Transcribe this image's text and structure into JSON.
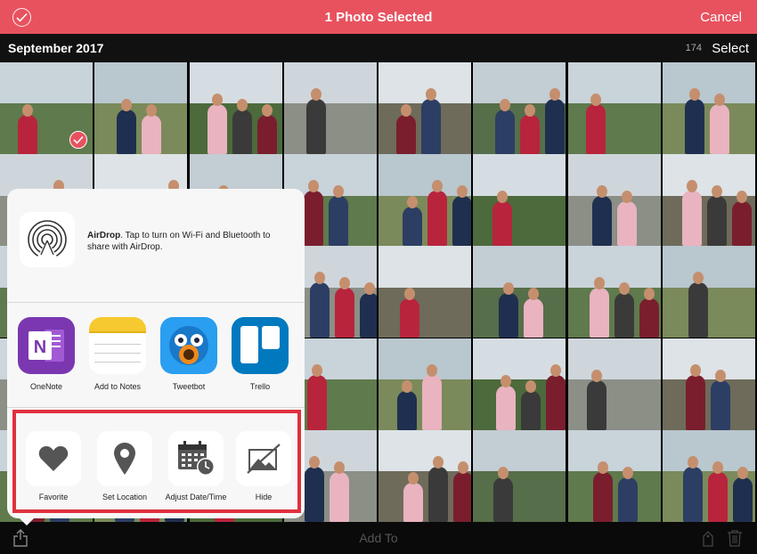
{
  "topbar": {
    "title": "1 Photo Selected",
    "cancel_label": "Cancel",
    "bg_color": "#e8525f"
  },
  "section": {
    "date": "September 2017",
    "count": "174",
    "select_label": "Select"
  },
  "share_sheet": {
    "airdrop_title": "AirDrop",
    "airdrop_message": ". Tap to turn on Wi-Fi and Bluetooth to share with AirDrop.",
    "apps": [
      {
        "label": "OneNote",
        "icon": "onenote-icon"
      },
      {
        "label": "Add to Notes",
        "icon": "notes-icon"
      },
      {
        "label": "Tweetbot",
        "icon": "tweetbot-icon"
      },
      {
        "label": "Trello",
        "icon": "trello-icon"
      }
    ],
    "actions": [
      {
        "label": "Favorite",
        "icon": "heart-icon"
      },
      {
        "label": "Set Location",
        "icon": "location-pin-icon"
      },
      {
        "label": "Adjust Date/Time",
        "icon": "calendar-clock-icon"
      },
      {
        "label": "Hide",
        "icon": "hide-icon"
      }
    ],
    "highlight_color": "#e0303f"
  },
  "toolbar": {
    "add_to_label": "Add To"
  }
}
